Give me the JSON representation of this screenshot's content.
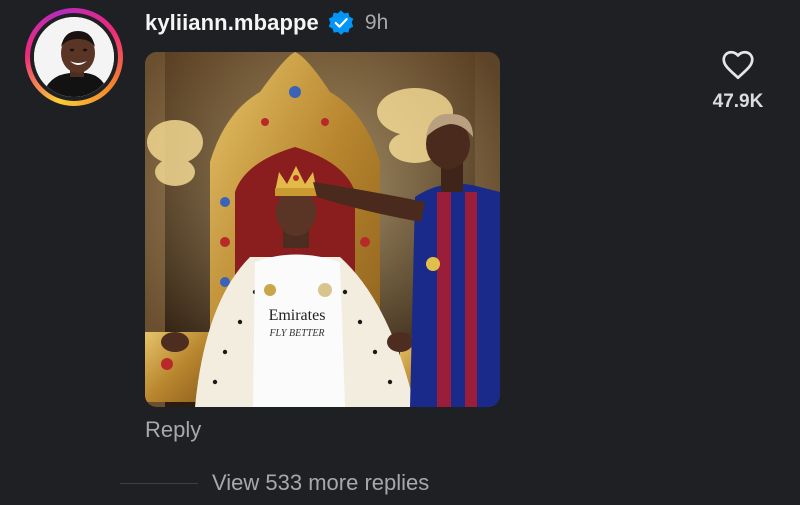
{
  "comment": {
    "username": "kyliiann.mbappe",
    "timestamp": "9h",
    "verified": true,
    "like_count": "47.9K",
    "reply_label": "Reply",
    "view_replies_label": "View 533 more replies",
    "media_overlay_text": [
      "Emirates",
      "FLY BETTER"
    ]
  },
  "icons": {
    "verified": "verified-badge-icon",
    "like": "heart-outline-icon"
  },
  "colors": {
    "background": "#1f2024",
    "verified_blue": "#0095f6",
    "secondary_text": "#a8a8a8",
    "primary_text": "#f5f5f5"
  }
}
